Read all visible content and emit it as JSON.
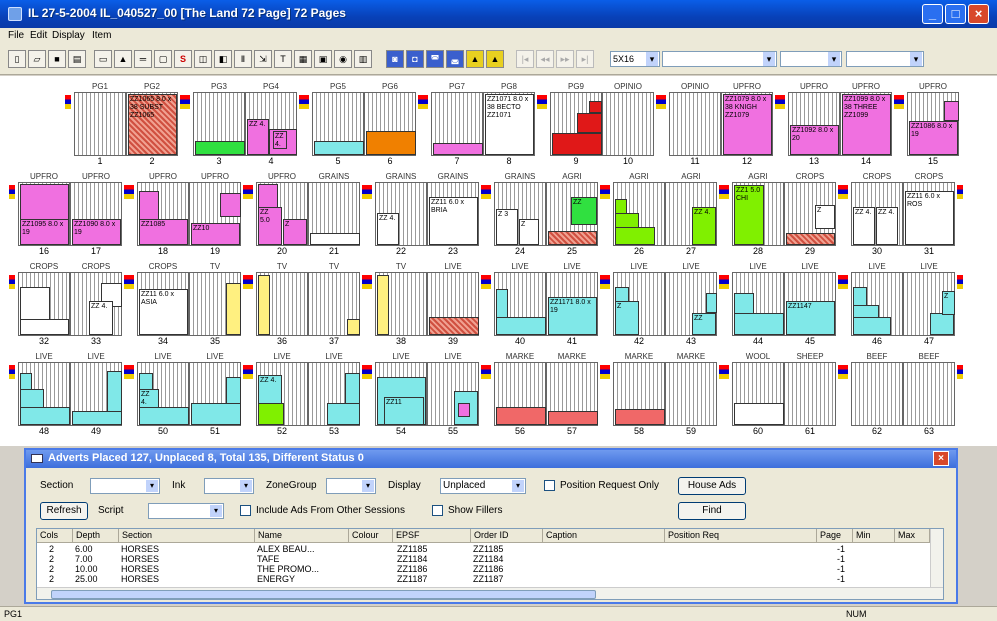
{
  "window": {
    "title": "IL 27-5-2004 IL_040527_00 [The Land 72 Page] 72 Pages"
  },
  "menu": [
    "File",
    "Edit",
    "Display",
    "Item"
  ],
  "toolbar": {
    "zoom_value": "5X16"
  },
  "pages": [
    {
      "label": "PG1",
      "num": "1"
    },
    {
      "label": "PG2",
      "num": "2"
    },
    {
      "label": "PG3",
      "num": "3"
    },
    {
      "label": "PG4",
      "num": "4"
    },
    {
      "label": "PG5",
      "num": "5"
    },
    {
      "label": "PG6",
      "num": "6"
    },
    {
      "label": "PG7",
      "num": "7"
    },
    {
      "label": "PG8",
      "num": "8"
    },
    {
      "label": "PG9",
      "num": "9"
    },
    {
      "label": "OPINIO",
      "num": "10"
    },
    {
      "label": "OPINIO",
      "num": "11"
    },
    {
      "label": "UPFRO",
      "num": "12"
    },
    {
      "label": "UPFRO",
      "num": "13"
    },
    {
      "label": "UPFRO",
      "num": "14"
    },
    {
      "label": "UPFRO",
      "num": "15"
    },
    {
      "label": "UPFRO",
      "num": "16"
    },
    {
      "label": "UPFRO",
      "num": "17"
    },
    {
      "label": "UPFRO",
      "num": "18"
    },
    {
      "label": "UPFRO",
      "num": "19"
    },
    {
      "label": "UPFRO",
      "num": "20"
    },
    {
      "label": "GRAINS",
      "num": "21"
    },
    {
      "label": "GRAINS",
      "num": "22"
    },
    {
      "label": "GRAINS",
      "num": "23"
    },
    {
      "label": "GRAINS",
      "num": "24"
    },
    {
      "label": "AGRI",
      "num": "25"
    },
    {
      "label": "AGRI",
      "num": "26"
    },
    {
      "label": "AGRI",
      "num": "27"
    },
    {
      "label": "AGRI",
      "num": "28"
    },
    {
      "label": "CROPS",
      "num": "29"
    },
    {
      "label": "CROPS",
      "num": "30"
    },
    {
      "label": "CROPS",
      "num": "31"
    },
    {
      "label": "CROPS",
      "num": "32"
    },
    {
      "label": "CROPS",
      "num": "33"
    },
    {
      "label": "CROPS",
      "num": "34"
    },
    {
      "label": "TV",
      "num": "35"
    },
    {
      "label": "TV",
      "num": "36"
    },
    {
      "label": "TV",
      "num": "37"
    },
    {
      "label": "TV",
      "num": "38"
    },
    {
      "label": "LIVE",
      "num": "39"
    },
    {
      "label": "LIVE",
      "num": "40"
    },
    {
      "label": "LIVE",
      "num": "41"
    },
    {
      "label": "LIVE",
      "num": "42"
    },
    {
      "label": "LIVE",
      "num": "43"
    },
    {
      "label": "LIVE",
      "num": "44"
    },
    {
      "label": "LIVE",
      "num": "45"
    },
    {
      "label": "LIVE",
      "num": "46"
    },
    {
      "label": "LIVE",
      "num": "47"
    },
    {
      "label": "LIVE",
      "num": "48"
    },
    {
      "label": "LIVE",
      "num": "49"
    },
    {
      "label": "LIVE",
      "num": "50"
    },
    {
      "label": "LIVE",
      "num": "51"
    },
    {
      "label": "LIVE",
      "num": "52"
    },
    {
      "label": "LIVE",
      "num": "53"
    },
    {
      "label": "LIVE",
      "num": "54"
    },
    {
      "label": "LIVE",
      "num": "55"
    },
    {
      "label": "MARKE",
      "num": "56"
    },
    {
      "label": "MARKE",
      "num": "57"
    },
    {
      "label": "MARKE",
      "num": "58"
    },
    {
      "label": "MARKE",
      "num": "59"
    },
    {
      "label": "WOOL",
      "num": "60"
    },
    {
      "label": "SHEEP",
      "num": "61"
    },
    {
      "label": "BEEF",
      "num": "62"
    },
    {
      "label": "BEEF",
      "num": "63"
    }
  ],
  "ads": {
    "pg2": "ZZ1065 8.0 x 38 SUBST ZZ1065",
    "pg4a": "ZZ 4.",
    "pg4b": "ZZ 4.",
    "pg8": "ZZ1071 8.0 x 38 BECTO ZZ1071",
    "pg12": "ZZ1079 8.0 x 38 KNIGH ZZ1079",
    "pg13": "ZZ1092 8.0 x 20",
    "pg14": "ZZ1099 8.0 x 38 THREE ZZ1099",
    "pg15": "ZZ1086 8.0 x 19",
    "pg16": "ZZ1095 8.0 x 19",
    "pg17": "ZZ1090 8.0 x 19",
    "pg18": "ZZ1085",
    "pg19": "ZZ10",
    "pg20a": "ZZ 5.0",
    "pg20b": "Z",
    "pg22": "ZZ 4.",
    "pg23": "ZZ11 6.0 x BRIA",
    "pg24a": "Z 3",
    "pg24b": "Z",
    "pg25": "ZZ",
    "pg27": "ZZ 4.",
    "pg28": "ZZ1 5.0 CHI",
    "pg29": "Z",
    "pg30a": "ZZ 4.",
    "pg30b": "ZZ 4.",
    "pg31": "ZZ11 6.0 x ROS",
    "pg33": "ZZ 4.",
    "pg34": "ZZ11 6.0 x ASIA",
    "pg41": "ZZ1171 8.0 x 19",
    "pg42": "Z",
    "pg43": "ZZ",
    "pg45": "ZZ1147",
    "pg47": "Z",
    "pg50": "ZZ 4.",
    "pg52": "ZZ 4.",
    "pg54": "ZZ11"
  },
  "dialog": {
    "title": "Adverts Placed 127, Unplaced 8, Total 135, Different Status 0",
    "section_label": "Section",
    "ink_label": "Ink",
    "zonegroup_label": "ZoneGroup",
    "display_label": "Display",
    "display_value": "Unplaced",
    "position_request_label": "Position Request Only",
    "house_ads_button": "House Ads",
    "refresh_button": "Refresh",
    "script_label": "Script",
    "include_ads_label": "Include Ads From Other Sessions",
    "show_fillers_label": "Show Fillers",
    "find_button": "Find",
    "columns": [
      "Cols",
      "Depth",
      "Section",
      "Name",
      "Colour",
      "EPSF",
      "Order ID",
      "Caption",
      "Position Req",
      "Page",
      "Min",
      "Max"
    ],
    "rows": [
      {
        "cols": "2",
        "depth": "6.00",
        "section": "HORSES",
        "name": "ALEX BEAU...",
        "epsf": "ZZ1185",
        "order": "ZZ1185",
        "page": "-1"
      },
      {
        "cols": "2",
        "depth": "7.00",
        "section": "HORSES",
        "name": "TAFE",
        "epsf": "ZZ1184",
        "order": "ZZ1184",
        "page": "-1"
      },
      {
        "cols": "2",
        "depth": "10.00",
        "section": "HORSES",
        "name": "THE PROMO...",
        "epsf": "ZZ1186",
        "order": "ZZ1186",
        "page": "-1"
      },
      {
        "cols": "2",
        "depth": "25.00",
        "section": "HORSES",
        "name": "ENERGY",
        "epsf": "ZZ1187",
        "order": "ZZ1187",
        "page": "-1"
      }
    ]
  },
  "status": {
    "left": "PG1",
    "right": "NUM"
  }
}
